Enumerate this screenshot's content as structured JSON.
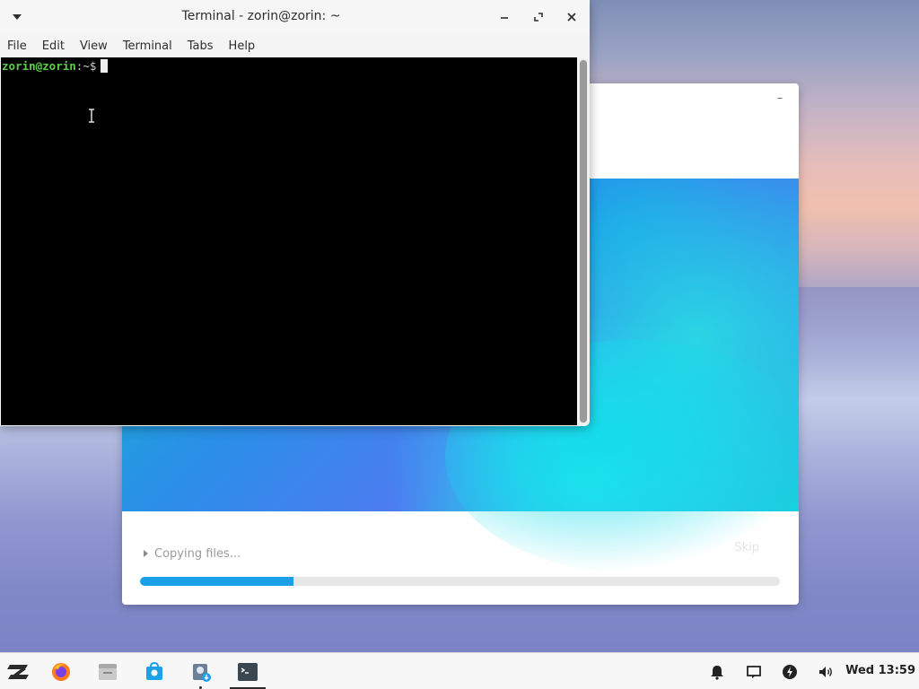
{
  "terminal": {
    "title": "Terminal - zorin@zorin: ~",
    "menu": [
      "File",
      "Edit",
      "View",
      "Terminal",
      "Tabs",
      "Help"
    ],
    "prompt_user": "zorin@zorin",
    "prompt_rest": ":~$"
  },
  "installer": {
    "minimize_label": "–",
    "status_text": "Copying files...",
    "skip_label": "Skip",
    "progress": 0.24
  },
  "taskbar": {
    "clock": "Wed 13:59",
    "icons": [
      "zorin-menu-icon",
      "firefox-icon",
      "files-icon",
      "software-store-icon",
      "installer-icon",
      "terminal-icon"
    ],
    "tray": [
      "bell-icon",
      "display-icon",
      "power-icon",
      "volume-icon"
    ]
  },
  "colors": {
    "accent": "#1aa0e6",
    "prompt_green": "#5ccf4b"
  }
}
